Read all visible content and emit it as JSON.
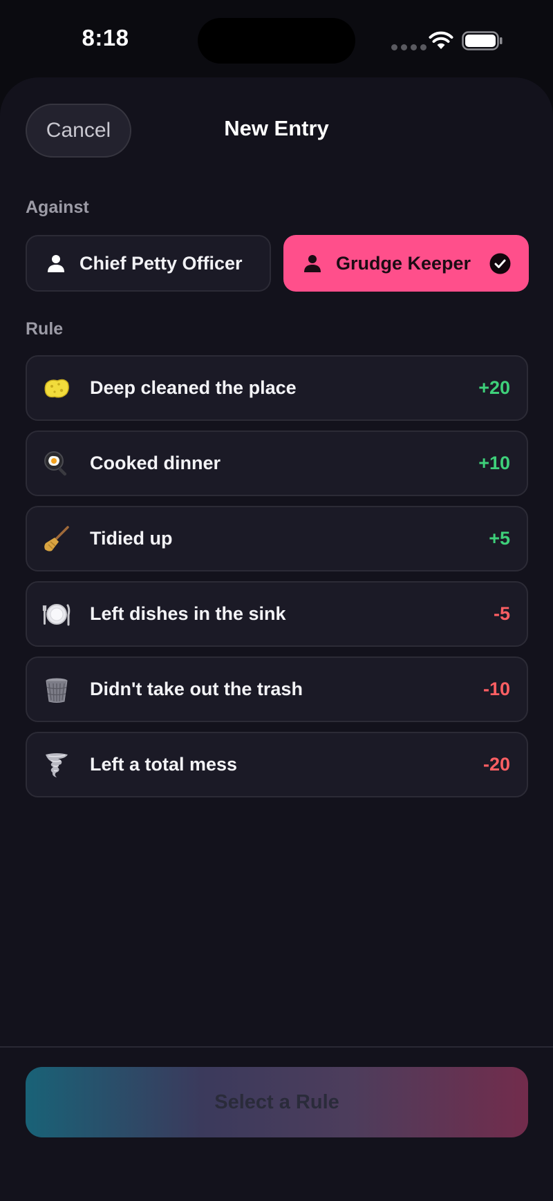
{
  "status_bar": {
    "time": "8:18"
  },
  "sheet": {
    "cancel_label": "Cancel",
    "title": "New Entry"
  },
  "against": {
    "label": "Against",
    "options": [
      {
        "name": "Chief Petty Officer",
        "selected": false
      },
      {
        "name": "Grudge Keeper",
        "selected": true
      }
    ]
  },
  "rules": {
    "label": "Rule",
    "items": [
      {
        "icon": "sponge-icon",
        "label": "Deep cleaned the place",
        "points": "+20"
      },
      {
        "icon": "frying-pan-icon",
        "label": "Cooked dinner",
        "points": "+10"
      },
      {
        "icon": "broom-icon",
        "label": "Tidied up",
        "points": "+5"
      },
      {
        "icon": "plate-icon",
        "label": "Left dishes in the sink",
        "points": "-5"
      },
      {
        "icon": "trash-can-icon",
        "label": "Didn't take out the trash",
        "points": "-10"
      },
      {
        "icon": "tornado-icon",
        "label": "Left a total mess",
        "points": "-20"
      }
    ]
  },
  "action": {
    "select_rule_label": "Select a Rule"
  },
  "colors": {
    "accent_pink": "#ff4f8b",
    "positive": "#3ed07a",
    "negative": "#ff5f63",
    "background": "#13121c"
  }
}
